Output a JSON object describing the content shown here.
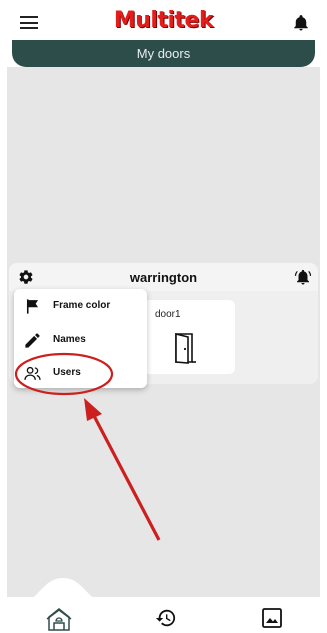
{
  "app": {
    "logo_text": "Multitek",
    "brand_color": "#e31c1c",
    "banner_color": "#2d4d4a"
  },
  "header": {
    "menu_icon": "hamburger-menu-icon",
    "notification_icon": "bell-icon"
  },
  "banner": {
    "title": "My doors"
  },
  "group": {
    "name": "warrington",
    "settings_icon": "gear-icon",
    "alarm_icon": "alarm-icon",
    "doors": [
      {
        "name": "door1",
        "icon": "door-icon"
      }
    ]
  },
  "popup_menu": {
    "items": [
      {
        "label": "Frame color",
        "icon": "flag-icon"
      },
      {
        "label": "Names",
        "icon": "pencil-icon"
      },
      {
        "label": "Users",
        "icon": "users-icon"
      }
    ]
  },
  "annotation": {
    "color": "#cc1f1f",
    "target": "Users"
  },
  "bottom_nav": {
    "items": [
      {
        "icon": "home-icon",
        "active": true
      },
      {
        "icon": "history-icon",
        "active": false
      },
      {
        "icon": "gallery-icon",
        "active": false
      }
    ]
  }
}
